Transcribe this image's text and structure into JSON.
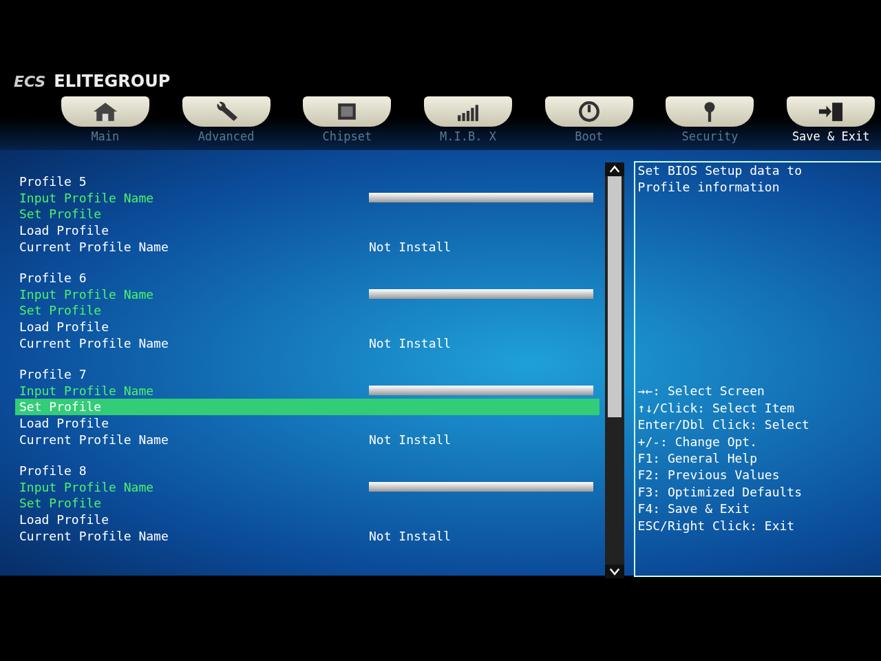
{
  "header": {
    "logo": "ECS",
    "brand": "ELITEGROUP"
  },
  "tabs": [
    {
      "label": "Main",
      "selected": false
    },
    {
      "label": "Advanced",
      "selected": false
    },
    {
      "label": "Chipset",
      "selected": false
    },
    {
      "label": "M.I.B. X",
      "selected": false
    },
    {
      "label": "Boot",
      "selected": false
    },
    {
      "label": "Security",
      "selected": false
    },
    {
      "label": "Save & Exit",
      "selected": true
    }
  ],
  "profiles": [
    {
      "items": [
        {
          "kind": "header",
          "label": "Profile 5",
          "selected": false
        },
        {
          "kind": "field",
          "label": "Input Profile Name",
          "selected": false
        },
        {
          "kind": "action",
          "label": "Set Profile",
          "disabled": false,
          "selected": false
        },
        {
          "kind": "action",
          "label": "Load Profile",
          "disabled": true,
          "selected": false
        },
        {
          "kind": "info",
          "label": "Current Profile Name",
          "value": "Not Install",
          "selected": false
        }
      ]
    },
    {
      "items": [
        {
          "kind": "header",
          "label": "Profile 6",
          "selected": false
        },
        {
          "kind": "field",
          "label": "Input Profile Name",
          "selected": false
        },
        {
          "kind": "action",
          "label": "Set Profile",
          "disabled": false,
          "selected": false
        },
        {
          "kind": "action",
          "label": "Load Profile",
          "disabled": true,
          "selected": false
        },
        {
          "kind": "info",
          "label": "Current Profile Name",
          "value": "Not Install",
          "selected": false
        }
      ]
    },
    {
      "items": [
        {
          "kind": "header",
          "label": "Profile 7",
          "selected": false
        },
        {
          "kind": "field",
          "label": "Input Profile Name",
          "selected": false
        },
        {
          "kind": "action",
          "label": "Set Profile",
          "disabled": false,
          "selected": true
        },
        {
          "kind": "action",
          "label": "Load Profile",
          "disabled": true,
          "selected": false
        },
        {
          "kind": "info",
          "label": "Current Profile Name",
          "value": "Not Install",
          "selected": false
        }
      ]
    },
    {
      "items": [
        {
          "kind": "header",
          "label": "Profile 8",
          "selected": false
        },
        {
          "kind": "field",
          "label": "Input Profile Name",
          "selected": false
        },
        {
          "kind": "action",
          "label": "Set Profile",
          "disabled": false,
          "selected": false
        },
        {
          "kind": "action",
          "label": "Load Profile",
          "disabled": true,
          "selected": false
        },
        {
          "kind": "info",
          "label": "Current Profile Name",
          "value": "Not Install",
          "selected": false
        }
      ]
    }
  ],
  "help": {
    "description": "Set BIOS Setup data to Profile information",
    "keys": [
      "→←: Select Screen",
      "↑↓/Click: Select Item",
      "Enter/Dbl Click: Select",
      "+/-: Change Opt.",
      "F1: General Help",
      "F2: Previous Values",
      "F3: Optimized Defaults",
      "F4: Save & Exit",
      "ESC/Right Click: Exit"
    ]
  }
}
